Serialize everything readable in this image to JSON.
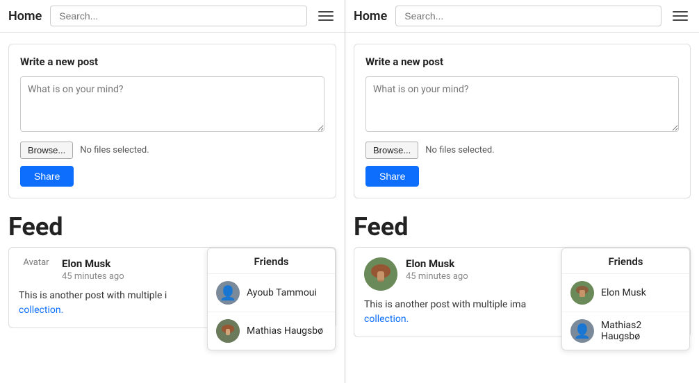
{
  "left": {
    "navbar": {
      "brand": "Home",
      "search_placeholder": "Search...",
      "menu_icon": "hamburger"
    },
    "write_post": {
      "title": "Write a new post",
      "textarea_placeholder": "What is on your mind?",
      "browse_label": "Browse...",
      "file_label": "No files selected.",
      "share_label": "Share"
    },
    "feed": {
      "title": "Feed",
      "posts": [
        {
          "avatar_text": "Avatar",
          "author": "Elon Musk",
          "time": "45 minutes ago",
          "text": "This is another post with multiple i",
          "text2": "collection."
        }
      ]
    },
    "friends_dropdown": {
      "title": "Friends",
      "items": [
        {
          "name": "Ayoub Tammoui",
          "has_avatar_img": false
        },
        {
          "name": "Mathias Haugsbø",
          "has_avatar_img": true
        }
      ]
    }
  },
  "right": {
    "navbar": {
      "brand": "Home",
      "search_placeholder": "Search...",
      "menu_icon": "hamburger"
    },
    "write_post": {
      "title": "Write a new post",
      "textarea_placeholder": "What is on your mind?",
      "browse_label": "Browse...",
      "file_label": "No files selected.",
      "share_label": "Share"
    },
    "feed": {
      "title": "Feed",
      "posts": [
        {
          "author": "Elon Musk",
          "time": "45 minutes ago",
          "text": "This is another post with multiple ima",
          "text2": "collection."
        }
      ]
    },
    "friends_dropdown": {
      "title": "Friends",
      "items": [
        {
          "name": "Elon Musk",
          "has_avatar_img": true
        },
        {
          "name": "Mathias2 Haugsbø",
          "has_avatar_img": false
        }
      ]
    }
  }
}
